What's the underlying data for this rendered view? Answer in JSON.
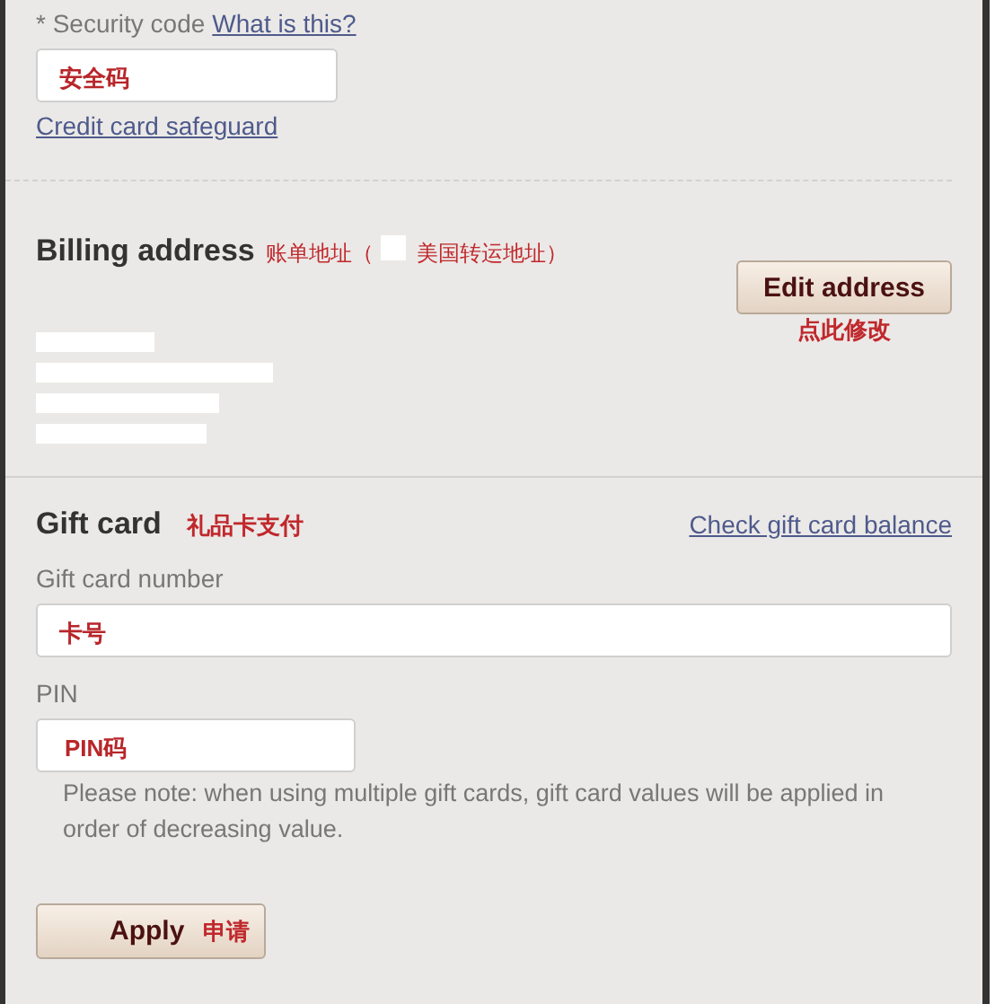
{
  "security": {
    "label": "* Security code",
    "help_link": "What is this?",
    "value": "安全码",
    "safeguard_link": "Credit card safeguard"
  },
  "billing": {
    "title": "Billing address",
    "note_before": "账单地址（",
    "note_after": "美国转运地址）",
    "edit_button": "Edit address",
    "edit_note": "点此修改"
  },
  "gift_card": {
    "title": "Gift card",
    "note": "礼品卡支付",
    "balance_link": "Check gift card balance",
    "number": {
      "label": "Gift card number",
      "value": "卡号"
    },
    "pin": {
      "label": "PIN",
      "value": "PIN码"
    },
    "notice": "Please note: when using multiple gift cards, gift card values will be applied in order of decreasing value.",
    "apply_button": "Apply",
    "apply_note": "申请"
  }
}
